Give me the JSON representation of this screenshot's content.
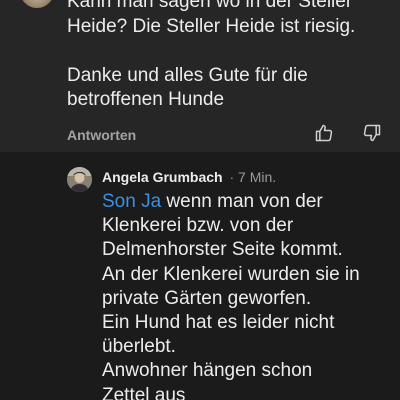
{
  "first_comment": {
    "paragraphs": [
      "Kann man sagen wo in der Steller\nHeide? Die Steller Heide ist riesig.",
      "Danke und alles Gute für die\nbetroffenen Hunde"
    ],
    "reply_label": "Antworten",
    "icons": {
      "like": "thumbs-up-icon",
      "dislike": "thumbs-down-icon"
    }
  },
  "reply_comment": {
    "author": "Angela Grumbach",
    "separator": "·",
    "time": "7 Min.",
    "mention": "Son Ja",
    "lines": [
      " wenn man von der",
      "Klenkerei bzw. von der",
      "Delmenhorster Seite kommt.",
      "An der Klenkerei wurden sie in",
      "private Gärten geworfen.",
      "Ein Hund hat es leider nicht",
      "überlebt.",
      "Anwohner hängen schon",
      "Zettel aus"
    ]
  },
  "colors": {
    "background_top": "#262626",
    "background_reply": "#1b1b1b",
    "text": "#ececec",
    "muted": "#a3a3a3",
    "mention": "#3d8fe0"
  }
}
